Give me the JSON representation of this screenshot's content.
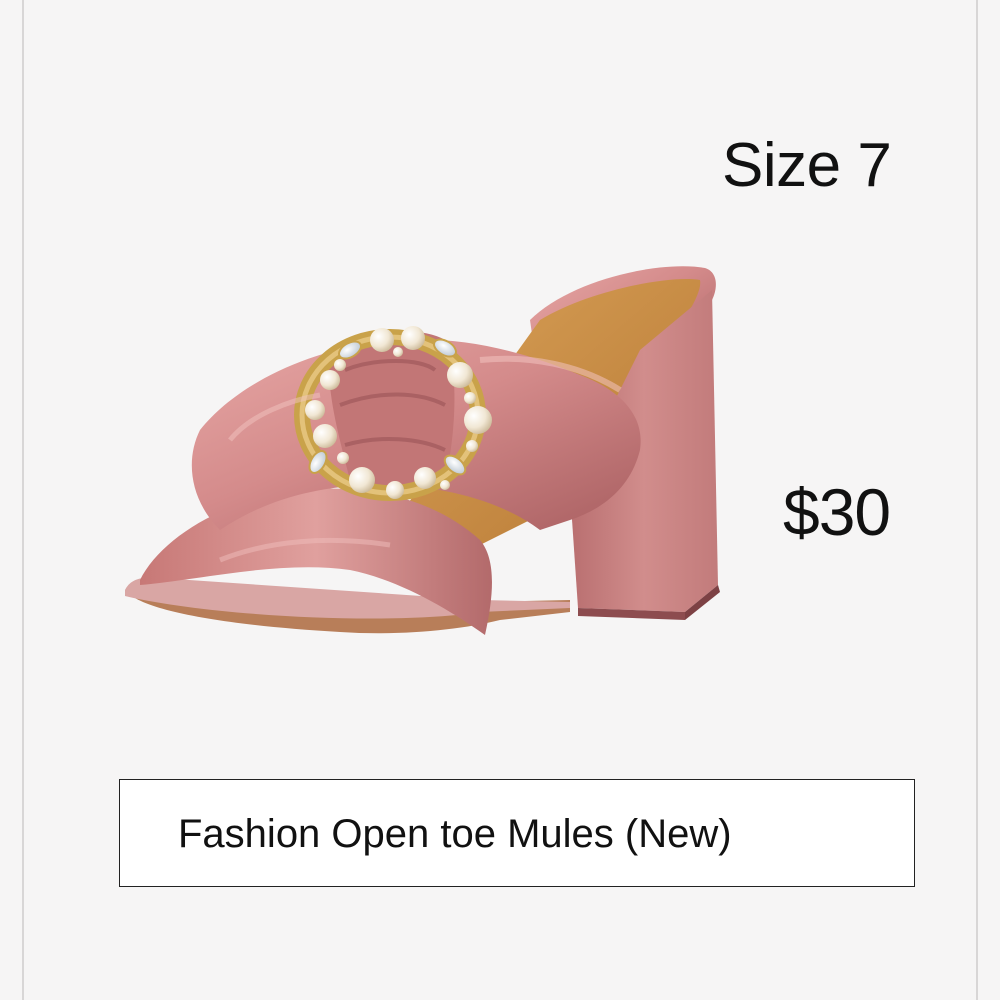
{
  "listing": {
    "size": "Size 7",
    "price": "$30",
    "title": "Fashion Open toe Mules (New)"
  },
  "product_image": {
    "subject": "pink satin block-heel mule sandal with pearl buckle",
    "colors": {
      "satin": "#d98f8f",
      "satin_shadow": "#a85e60",
      "insole": "#c8893f",
      "pearl": "#f4ecdc",
      "buckle_gold": "#c9a24a"
    }
  }
}
